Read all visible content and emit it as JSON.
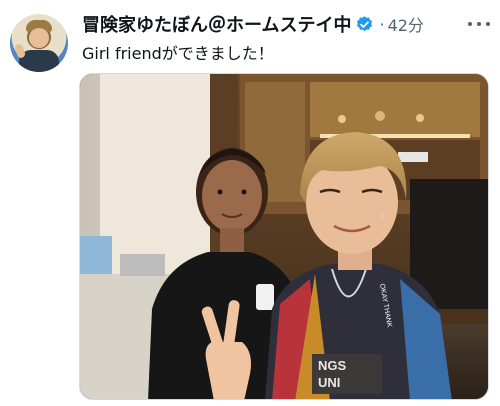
{
  "tweet": {
    "author_name": "冒険家ゆたぼん＠ホームステイ中",
    "separator": "·",
    "timestamp": "42分",
    "text": "Girl friendができました！",
    "verified": true
  },
  "icons": {
    "verified": "verified-badge-icon",
    "more": "more-options-icon"
  },
  "photo": {
    "shirt_prints": [
      "NGS",
      "UNI"
    ],
    "lanyard_text": "OKAY THANK"
  },
  "colors": {
    "accent": "#1d9bf0",
    "text": "#0f1419",
    "muted": "#536471",
    "border": "#cfd9de"
  }
}
